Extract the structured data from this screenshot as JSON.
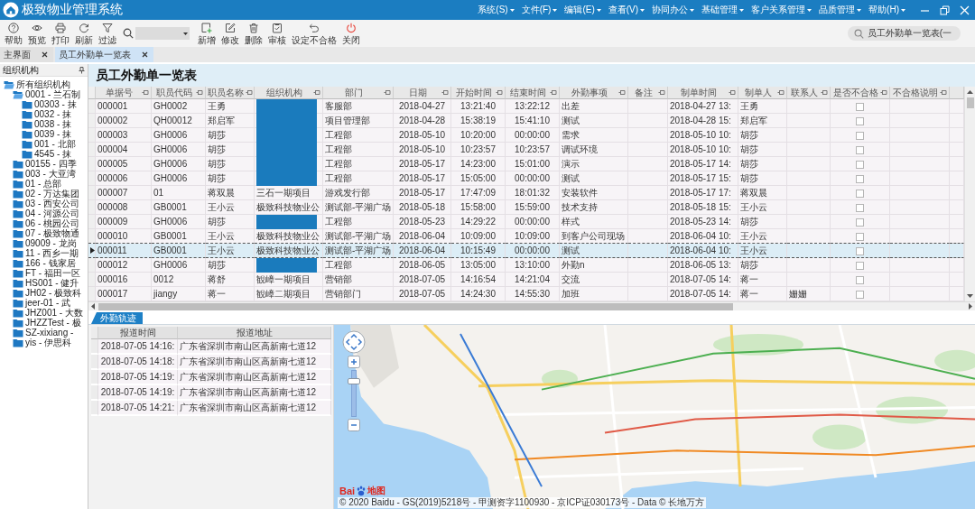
{
  "title_bar": {
    "title": "极致物业管理系统",
    "menu": [
      "系统(S)",
      "文件(F)",
      "编辑(E)",
      "查看(V)",
      "协同办公",
      "基础管理",
      "客户关系管理",
      "品质管理",
      "帮助(H)"
    ]
  },
  "toolbar": {
    "buttons_left": [
      "帮助",
      "预览",
      "打印",
      "刷新",
      "过滤"
    ],
    "buttons_right": [
      "新增",
      "修改",
      "删除",
      "审核",
      "设定不合格",
      "关闭"
    ],
    "search": {
      "value": "员工外勤单一览表(一"
    }
  },
  "tabs": [
    {
      "label": "主界面",
      "selected": false
    },
    {
      "label": "员工外勤单一览表",
      "selected": true
    }
  ],
  "org_panel": {
    "title": "组织机构",
    "tree": [
      {
        "label": "所有组织机构",
        "expanded": true,
        "children": [
          {
            "label": "0001 - 兰石制",
            "expanded": true,
            "children": [
              {
                "label": "00303 - 抹",
                "expanded": false
              },
              {
                "label": "0032 - 抹",
                "expanded": false
              },
              {
                "label": "0038 - 抹",
                "expanded": false
              },
              {
                "label": "0039 - 抹",
                "expanded": false
              },
              {
                "label": "001 - 北部",
                "expanded": false
              },
              {
                "label": "4545 - 抹",
                "expanded": false
              }
            ]
          },
          {
            "label": "00155 - 四季",
            "expanded": false
          },
          {
            "label": "003 - 大亚湾",
            "expanded": false
          },
          {
            "label": "01 - 总部",
            "expanded": false
          },
          {
            "label": "02 - 万达集团",
            "expanded": false
          },
          {
            "label": "03 - 西安公司",
            "expanded": false
          },
          {
            "label": "04 - 河源公司",
            "expanded": false
          },
          {
            "label": "06 - 桃园公司",
            "expanded": false
          },
          {
            "label": "07 - 极致物通",
            "expanded": false
          },
          {
            "label": "09009 - 龙岗",
            "expanded": false
          },
          {
            "label": "11 - 西乡一期",
            "expanded": false
          },
          {
            "label": "166 - 钱家居",
            "expanded": false
          },
          {
            "label": "FT - 福田一区",
            "expanded": false
          },
          {
            "label": "HS001 - 健升",
            "expanded": false
          },
          {
            "label": "JH02 - 极致科",
            "expanded": false
          },
          {
            "label": "jeer-01 - 武",
            "expanded": false
          },
          {
            "label": "JHZ001 - 大数",
            "expanded": false
          },
          {
            "label": "JHZZTest - 极",
            "expanded": false
          },
          {
            "label": "SZ-xixiang -",
            "expanded": false
          },
          {
            "label": "yis - 伊思科",
            "expanded": false
          }
        ]
      }
    ]
  },
  "page_title": "员工外勤单一览表",
  "table": {
    "columns": [
      "单据号",
      "职员代码",
      "职员名称",
      "组织机构",
      "部门",
      "日期",
      "开始时间",
      "结束时间",
      "外勤事项",
      "备注",
      "制单时间",
      "制单人",
      "联系人",
      "是否不合格",
      "不合格说明"
    ],
    "rows": [
      {
        "selected": false,
        "doc_no": "000001",
        "staff_code": "GH0002",
        "staff_name": "王勇",
        "org": {
          "redacted": true
        },
        "dept": "客服部",
        "date": "2018-04-27",
        "start_time": "13:21:40",
        "end_time": "13:22:12",
        "task": "出差",
        "created_at": "2018-04-27 13:",
        "creator": "王勇",
        "unqualified": false
      },
      {
        "selected": false,
        "doc_no": "000002",
        "staff_code": "QH00012",
        "staff_name": "郑启军",
        "org": {
          "redacted": true
        },
        "dept": "项目管理部",
        "date": "2018-04-28",
        "start_time": "15:38:19",
        "end_time": "15:41:10",
        "task": "测试",
        "created_at": "2018-04-28 15:",
        "creator": "郑启军",
        "unqualified": false
      },
      {
        "selected": false,
        "doc_no": "000003",
        "staff_code": "GH0006",
        "staff_name": "胡莎",
        "org": {
          "redacted": true
        },
        "dept": "工程部",
        "date": "2018-05-10",
        "start_time": "10:20:00",
        "end_time": "00:00:00",
        "task": "需求",
        "created_at": "2018-05-10 10:",
        "creator": "胡莎",
        "unqualified": false
      },
      {
        "selected": false,
        "doc_no": "000004",
        "staff_code": "GH0006",
        "staff_name": "胡莎",
        "org": {
          "redacted": true
        },
        "dept": "工程部",
        "date": "2018-05-10",
        "start_time": "10:23:57",
        "end_time": "10:23:57",
        "task": "调试环境",
        "created_at": "2018-05-10 10:",
        "creator": "胡莎",
        "unqualified": false
      },
      {
        "selected": false,
        "doc_no": "000005",
        "staff_code": "GH0006",
        "staff_name": "胡莎",
        "org": {
          "redacted": true
        },
        "dept": "工程部",
        "date": "2018-05-17",
        "start_time": "14:23:00",
        "end_time": "15:01:00",
        "task": "演示",
        "created_at": "2018-05-17 14:",
        "creator": "胡莎",
        "unqualified": false
      },
      {
        "selected": false,
        "doc_no": "000006",
        "staff_code": "GH0006",
        "staff_name": "胡莎",
        "org": {
          "redacted": true
        },
        "dept": "工程部",
        "date": "2018-05-17",
        "start_time": "15:05:00",
        "end_time": "00:00:00",
        "task": "测试",
        "created_at": "2018-05-17 15:",
        "creator": "胡莎",
        "unqualified": false
      },
      {
        "selected": false,
        "doc_no": "000007",
        "staff_code": "01",
        "staff_name": "蒋双晨",
        "org": {
          "text": "三石一期项目",
          "redacted": false
        },
        "dept": "游戏发行部",
        "date": "2018-05-17",
        "start_time": "17:47:09",
        "end_time": "18:01:32",
        "task": "安装软件",
        "created_at": "2018-05-17 17:",
        "creator": "蒋双晨",
        "unqualified": false
      },
      {
        "selected": false,
        "doc_no": "000008",
        "staff_code": "GB0001",
        "staff_name": "王小云",
        "org": {
          "text": "极致科技物业公",
          "redacted": false
        },
        "dept": "测试部-平湖广场",
        "date": "2018-05-18",
        "start_time": "15:58:00",
        "end_time": "15:59:00",
        "task": "技术支持",
        "created_at": "2018-05-18 15:",
        "creator": "王小云",
        "unqualified": false
      },
      {
        "selected": false,
        "doc_no": "000009",
        "staff_code": "GH0006",
        "staff_name": "胡莎",
        "org": {
          "redacted": true
        },
        "dept": "工程部",
        "date": "2018-05-23",
        "start_time": "14:29:22",
        "end_time": "00:00:00",
        "task": "样式",
        "created_at": "2018-05-23 14:",
        "creator": "胡莎",
        "unqualified": false
      },
      {
        "selected": false,
        "doc_no": "000010",
        "staff_code": "GB0001",
        "staff_name": "王小云",
        "org": {
          "text": "极致科技物业公",
          "redacted": false
        },
        "dept": "测试部-平湖广场",
        "date": "2018-06-04",
        "start_time": "10:09:00",
        "end_time": "10:09:00",
        "task": "到客户公司现场",
        "created_at": "2018-06-04 10:",
        "creator": "王小云",
        "unqualified": false
      },
      {
        "selected": true,
        "doc_no": "000011",
        "staff_code": "GB0001",
        "staff_name": "王小云",
        "org": {
          "text": "极致科技物业公",
          "redacted": false
        },
        "dept": "测试部-平湖广场",
        "date": "2018-06-04",
        "start_time": "10:15:49",
        "end_time": "00:00:00",
        "task": "测试",
        "created_at": "2018-06-04 10:",
        "creator": "王小云",
        "unqualified": false
      },
      {
        "selected": false,
        "doc_no": "000012",
        "staff_code": "GH0006",
        "staff_name": "胡莎",
        "org": {
          "redacted": true
        },
        "dept": "工程部",
        "date": "2018-06-05",
        "start_time": "13:05:00",
        "end_time": "13:10:00",
        "task": "外勤n",
        "created_at": "2018-06-05 13:",
        "creator": "胡莎",
        "unqualified": false
      },
      {
        "selected": false,
        "doc_no": "000016",
        "staff_code": "0012",
        "staff_name": "蒋舒",
        "org": {
          "text": "観嶂一期项目",
          "redacted": false
        },
        "dept": "营销部",
        "date": "2018-07-05",
        "start_time": "14:16:54",
        "end_time": "14:21:04",
        "task": "交流",
        "created_at": "2018-07-05 14:",
        "creator": "蒋一",
        "unqualified": false
      },
      {
        "selected": false,
        "doc_no": "000017",
        "staff_code": "jiangy",
        "staff_name": "蒋一",
        "org": {
          "text": "観嶂二期项目",
          "redacted": false
        },
        "dept": "营销部门",
        "date": "2018-07-05",
        "start_time": "14:24:30",
        "end_time": "14:55:30",
        "task": "加班",
        "created_at": "2018-07-05 14:",
        "creator": "蒋一",
        "contact": "姗姗",
        "unqualified": false
      }
    ]
  },
  "detail_tabs": [
    {
      "label": "外勤轨迹",
      "selected": true
    }
  ],
  "track_list": {
    "columns": [
      "报道时间",
      "报道地址"
    ],
    "rows": [
      {
        "time": "2018-07-05 14:16:",
        "address": "广东省深圳市南山区高新南七道12"
      },
      {
        "time": "2018-07-05 14:18:",
        "address": "广东省深圳市南山区高新南七道12"
      },
      {
        "time": "2018-07-05 14:19:",
        "address": "广东省深圳市南山区高新南七道12"
      },
      {
        "time": "2018-07-05 14:19:",
        "address": "广东省深圳市南山区高新南七道12"
      },
      {
        "time": "2018-07-05 14:21:",
        "address": "广东省深圳市南山区高新南七道12"
      }
    ]
  },
  "map": {
    "zoom_slider": {
      "level": 0.8
    },
    "logo_prefix": "Bai",
    "logo_suffix": "地图",
    "copyright": "© 2020 Baidu - GS(2019)5218号 - 甲测资字1100930 - 京ICP证030173号 - Data © 长地万方"
  }
}
